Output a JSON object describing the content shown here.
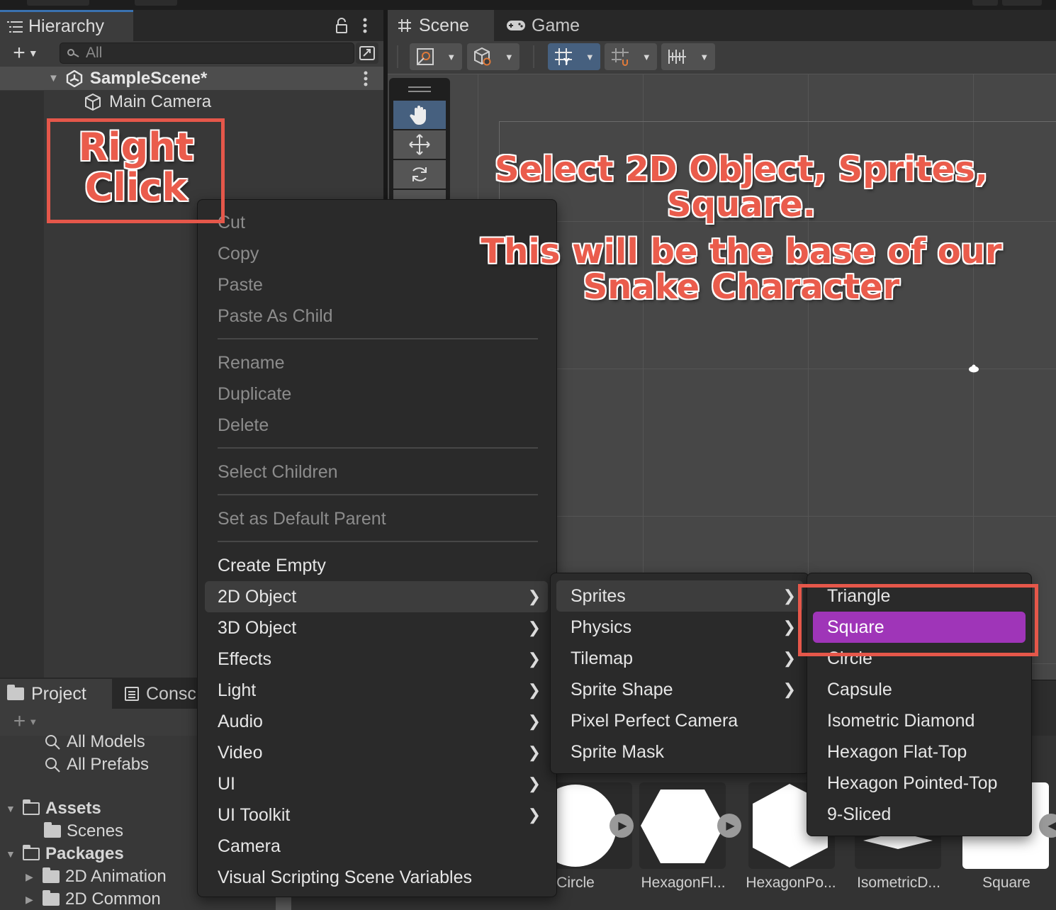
{
  "hierarchy": {
    "tab_label": "Hierarchy",
    "search_placeholder": "All",
    "scene_name": "SampleScene*",
    "objects": [
      "Main Camera"
    ]
  },
  "scene_panel": {
    "tabs": [
      {
        "label": "Scene",
        "icon": "grid-icon",
        "active": true
      },
      {
        "label": "Game",
        "icon": "gamepad-icon",
        "active": false
      }
    ]
  },
  "project_panel": {
    "tabs": [
      {
        "label": "Project",
        "icon": "folder-icon"
      },
      {
        "label": "Console",
        "visible_label": "Consc",
        "icon": "console-icon"
      }
    ],
    "searches": [
      "All Models",
      "All Prefabs"
    ],
    "tree": [
      {
        "label": "Assets",
        "expanded": true
      },
      {
        "label": "Scenes"
      },
      {
        "label": "Packages",
        "expanded": true
      },
      {
        "label": "2D Animation"
      },
      {
        "label": "2D Common"
      }
    ],
    "assets": [
      "Circle",
      "HexagonFl...",
      "HexagonPo...",
      "IsometricD...",
      "Square"
    ]
  },
  "context_menu": {
    "main": [
      {
        "label": "Cut",
        "enabled": false
      },
      {
        "label": "Copy",
        "enabled": false
      },
      {
        "label": "Paste",
        "enabled": false
      },
      {
        "label": "Paste As Child",
        "enabled": false
      },
      {
        "label": "Rename",
        "enabled": false
      },
      {
        "label": "Duplicate",
        "enabled": false
      },
      {
        "label": "Delete",
        "enabled": false
      },
      {
        "label": "Select Children",
        "enabled": false
      },
      {
        "label": "Set as Default Parent",
        "enabled": false
      },
      {
        "label": "Create Empty",
        "enabled": true
      },
      {
        "label": "2D Object",
        "enabled": true,
        "submenu": true
      },
      {
        "label": "3D Object",
        "enabled": true,
        "submenu": true
      },
      {
        "label": "Effects",
        "enabled": true,
        "submenu": true
      },
      {
        "label": "Light",
        "enabled": true,
        "submenu": true
      },
      {
        "label": "Audio",
        "enabled": true,
        "submenu": true
      },
      {
        "label": "Video",
        "enabled": true,
        "submenu": true
      },
      {
        "label": "UI",
        "enabled": true,
        "submenu": true
      },
      {
        "label": "UI Toolkit",
        "enabled": true,
        "submenu": true
      },
      {
        "label": "Camera",
        "enabled": true
      },
      {
        "label": "Visual Scripting Scene Variables",
        "enabled": true
      }
    ],
    "object_2d": [
      {
        "label": "Sprites",
        "submenu": true
      },
      {
        "label": "Physics",
        "submenu": true
      },
      {
        "label": "Tilemap",
        "submenu": true
      },
      {
        "label": "Sprite Shape",
        "submenu": true
      },
      {
        "label": "Pixel Perfect Camera"
      },
      {
        "label": "Sprite Mask"
      }
    ],
    "sprites": [
      {
        "label": "Triangle"
      },
      {
        "label": "Square",
        "selected": true
      },
      {
        "label": "Circle"
      },
      {
        "label": "Capsule"
      },
      {
        "label": "Isometric Diamond"
      },
      {
        "label": "Hexagon Flat-Top"
      },
      {
        "label": "Hexagon Pointed-Top"
      },
      {
        "label": "9-Sliced"
      }
    ]
  },
  "annotations": {
    "right_click": "Right Click",
    "instruction_1": "Select 2D Object, Sprites, Square.",
    "instruction_2": "This will be the base of our Snake Character"
  },
  "colors": {
    "selection_highlight": "#9f35b8",
    "annotation_red": "#e5574a",
    "active_tool_blue": "#46607f"
  }
}
